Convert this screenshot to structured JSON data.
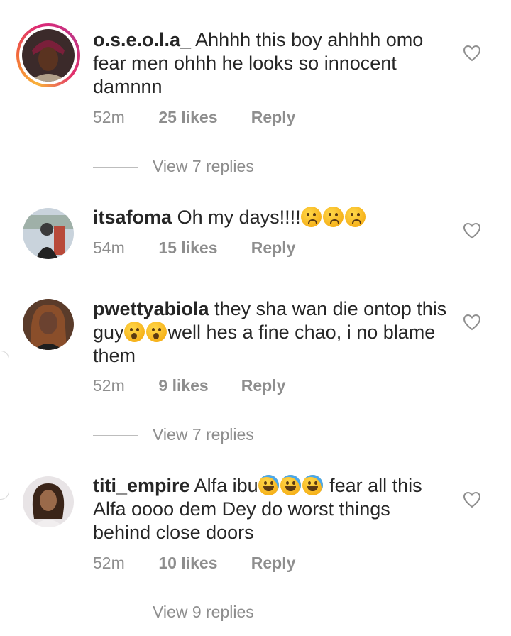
{
  "comments": [
    {
      "username": "o.s.e.o.l.a_",
      "text": "Ahhhh this boy ahhhh omo fear men ohhh he looks so innocent damnnn",
      "time": "52m",
      "likes": "25 likes",
      "reply_label": "Reply",
      "view_replies": "View 7 replies",
      "has_story": true
    },
    {
      "username": "itsafoma",
      "text": "Oh my days!!!!",
      "emoji": [
        "crying-face",
        "crying-face",
        "crying-face"
      ],
      "time": "54m",
      "likes": "15 likes",
      "reply_label": "Reply"
    },
    {
      "username": "pwettyabiola",
      "text_before": "they sha wan die ontop this guy",
      "emoji": [
        "astonished-face",
        "astonished-face"
      ],
      "text_after": "well hes a fine chao, i no blame them",
      "time": "52m",
      "likes": "9 likes",
      "reply_label": "Reply",
      "view_replies": "View 7 replies"
    },
    {
      "username": "titi_empire",
      "text_before": "Alfa ibu",
      "emoji": [
        "tears-of-joy-face",
        "tears-of-joy-face",
        "tears-of-joy-face"
      ],
      "text_after": " fear all this Alfa oooo dem Dey do worst things behind close doors",
      "time": "52m",
      "likes": "10 likes",
      "reply_label": "Reply",
      "view_replies": "View 9 replies"
    }
  ],
  "colors": {
    "text": "#262626",
    "muted": "#8e8e8e",
    "story_ring": "#dc2878"
  }
}
